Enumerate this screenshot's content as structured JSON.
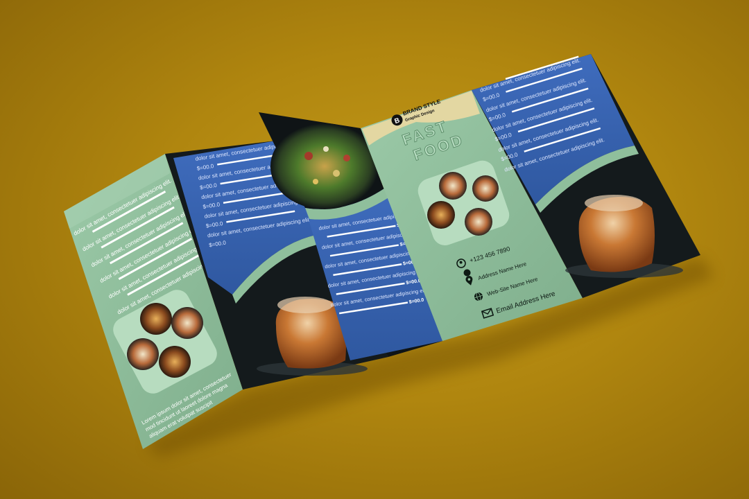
{
  "colors": {
    "background": "#b48a12",
    "panel_green": "#8fbf9c",
    "panel_blue": "#3b66b5",
    "dark": "#141a1c",
    "accent_yellow": "#e3d7a2"
  },
  "brand": {
    "logo_letter": "B",
    "name": "BRAND STYLE",
    "tagline": "Graphic Design"
  },
  "cover": {
    "title_line1": "FAST",
    "title_line2": "FOOD"
  },
  "contact": {
    "phone": "+123 456 7890",
    "address": "Address Name Here",
    "website": "Web-Site Name Here",
    "email": "Email Address Here",
    "icons": [
      "user-icon",
      "location-pin-icon",
      "globe-icon",
      "mail-icon"
    ]
  },
  "menu": {
    "item_text": "dolor sit amet, consectetuer adipiscing elit.",
    "price": "$=00.0"
  },
  "back_panel": {
    "lorem": "Lorem ipsum dolor sit amet, consectetuer",
    "lorem_line2": "mod tincidunt ut laoreet dolore magna",
    "lorem_line3": "aliquam erat volutpat suscipit"
  }
}
